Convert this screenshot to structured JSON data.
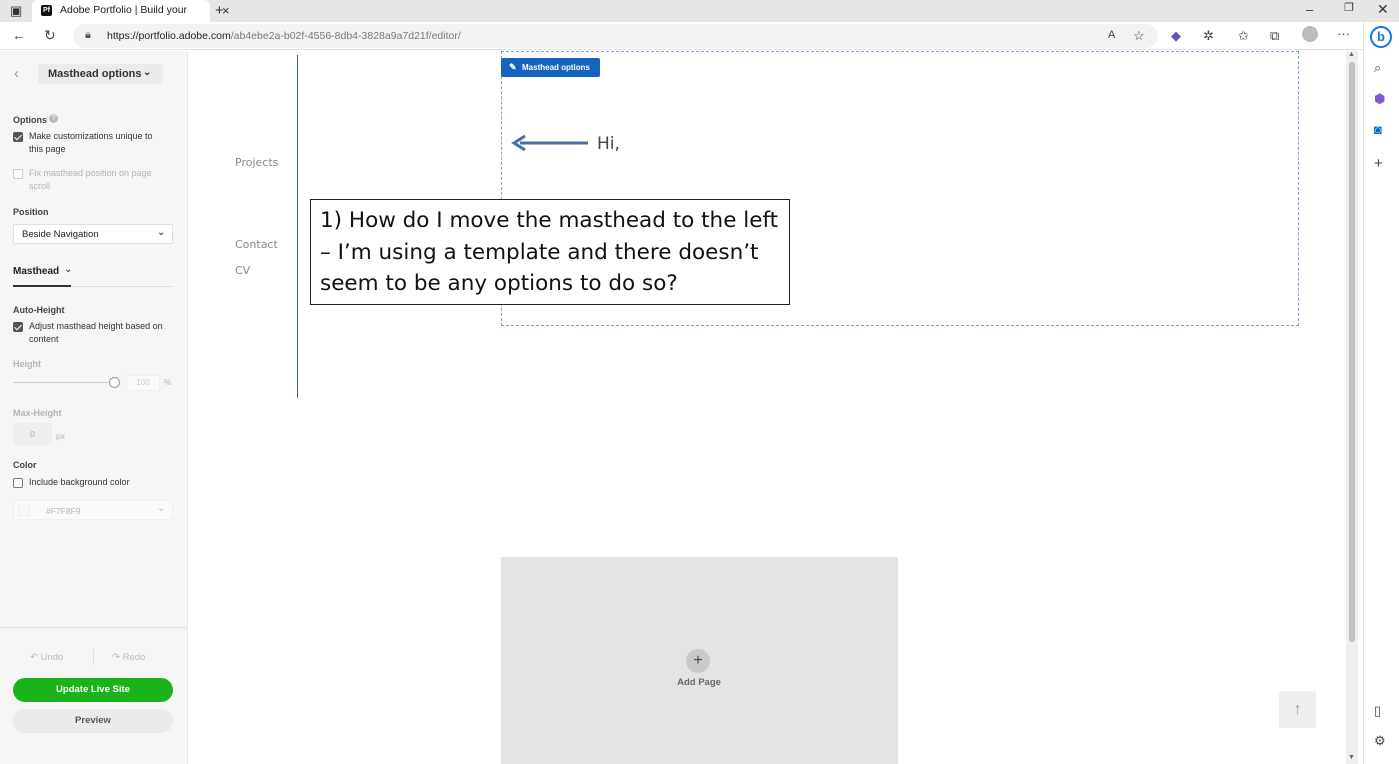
{
  "browser": {
    "tab_title": "Adobe Portfolio | Build your own",
    "tab_favicon": "Pf",
    "url_main": "https://portfolio.adobe.com",
    "url_rest": "/ab4ebe2a-b02f-4556-8db4-3828a9a7d21f/editor/",
    "read_aloud": "A",
    "more": "···"
  },
  "panel": {
    "header_dropdown": "Masthead options",
    "options_label": "Options",
    "unique_label": "Make customizations unique to this page",
    "unique_checked": true,
    "fix_label": "Fix masthead position on page scroll",
    "fix_checked": false,
    "position_label": "Position",
    "position_value": "Beside Navigation",
    "masthead_tab": "Masthead",
    "autoheight_label": "Auto-Height",
    "adjust_label": "Adjust masthead height based on content",
    "adjust_checked": true,
    "height_label": "Height",
    "height_value": "100",
    "height_unit": "%",
    "maxheight_label": "Max-Height",
    "maxheight_value": "0",
    "maxheight_unit": "px",
    "color_label": "Color",
    "bgcolor_label": "Include background color",
    "bgcolor_checked": false,
    "bgcolor_value": "#F7F8F9",
    "undo": "Undo",
    "redo": "Redo",
    "update_button": "Update Live Site",
    "preview_button": "Preview",
    "update_color": "#1ab31a"
  },
  "canvas": {
    "nav_projects": "Projects",
    "nav_contact": "Contact",
    "nav_cv": "CV",
    "masthead_options_button": "Masthead options",
    "masthead_text": "Hi,",
    "callout_text": "1) How do I move the masthead to the left – I’m using a template and there doesn’t seem to be any options to do so?",
    "add_page_label": "Add Page",
    "arrow_color": "#4a6fa5"
  }
}
